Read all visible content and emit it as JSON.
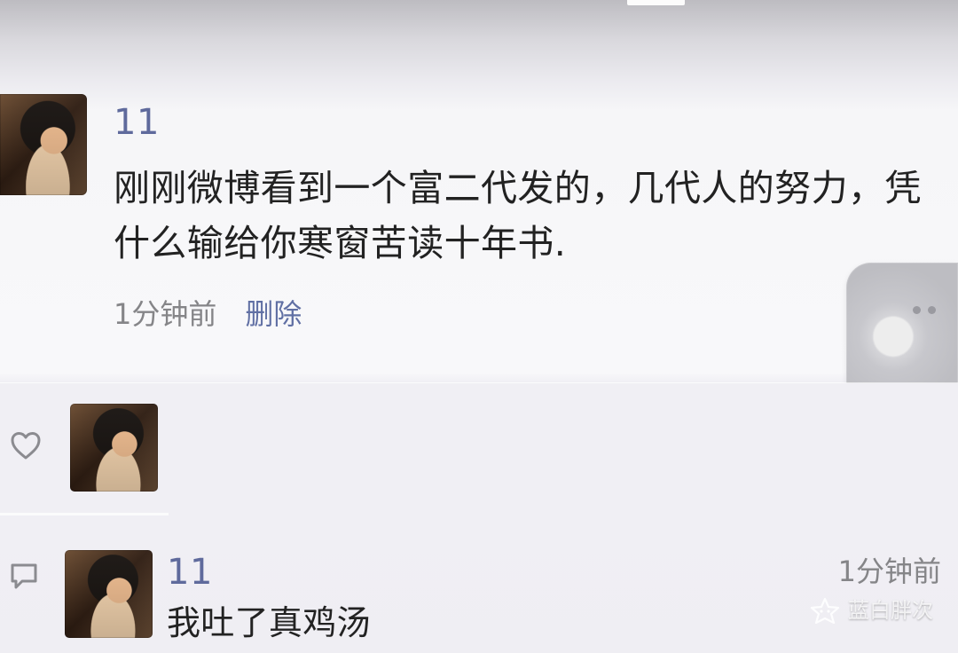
{
  "post": {
    "username": "11",
    "text": "刚刚微博看到一个富二代发的，几代人的努力，凭什么输给你寒窗苦读十年书.",
    "time": "1分钟前",
    "delete_label": "删除"
  },
  "interactions": {
    "like_icon": "heart-outline-icon",
    "comment_icon": "comment-outline-icon"
  },
  "comment": {
    "username": "11",
    "text": "我吐了真鸡汤",
    "time": "1分钟前"
  },
  "watermark": {
    "text": "蓝白胖次",
    "icon": "star-face-logo-icon"
  },
  "colors": {
    "username": "#5f6a9c",
    "link": "#6170a4",
    "meta": "#858588",
    "background": "#f8f8fa"
  }
}
